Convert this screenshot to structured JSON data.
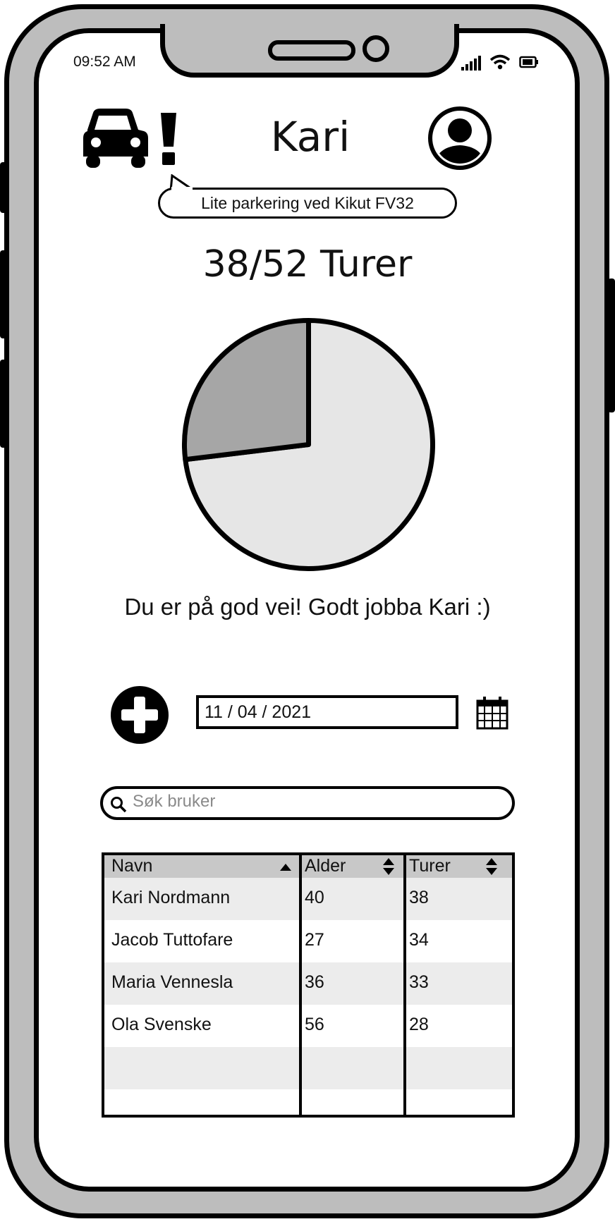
{
  "status_bar": {
    "time": "09:52 AM"
  },
  "header": {
    "title": "Kari",
    "notification": "Lite parkering ved Kikut FV32",
    "alert_icon": "car-alert-icon",
    "profile_icon": "user-avatar-icon"
  },
  "progress": {
    "label": "38/52 Turer",
    "completed": 38,
    "total": 52,
    "message": "Du er på god vei! Godt jobba Kari :)"
  },
  "chart_data": {
    "type": "pie",
    "values": [
      38,
      52
    ],
    "colors": [
      "#e6e6e6",
      "#a6a6a6"
    ]
  },
  "add_trip": {
    "date": "11  / 04 / 2021",
    "add_icon": "plus-circle-icon",
    "calendar_icon": "calendar-icon"
  },
  "search": {
    "placeholder": "Søk bruker",
    "icon": "search-icon"
  },
  "table": {
    "columns": [
      "Navn",
      "Alder",
      "Turer"
    ],
    "rows": [
      [
        "Kari Nordmann",
        "40",
        "38"
      ],
      [
        "Jacob Tuttofare",
        "27",
        "34"
      ],
      [
        "Maria Vennesla",
        "36",
        "33"
      ],
      [
        "Ola Svenske",
        "56",
        "28"
      ],
      [
        "",
        "",
        ""
      ],
      [
        "",
        "",
        ""
      ]
    ]
  }
}
